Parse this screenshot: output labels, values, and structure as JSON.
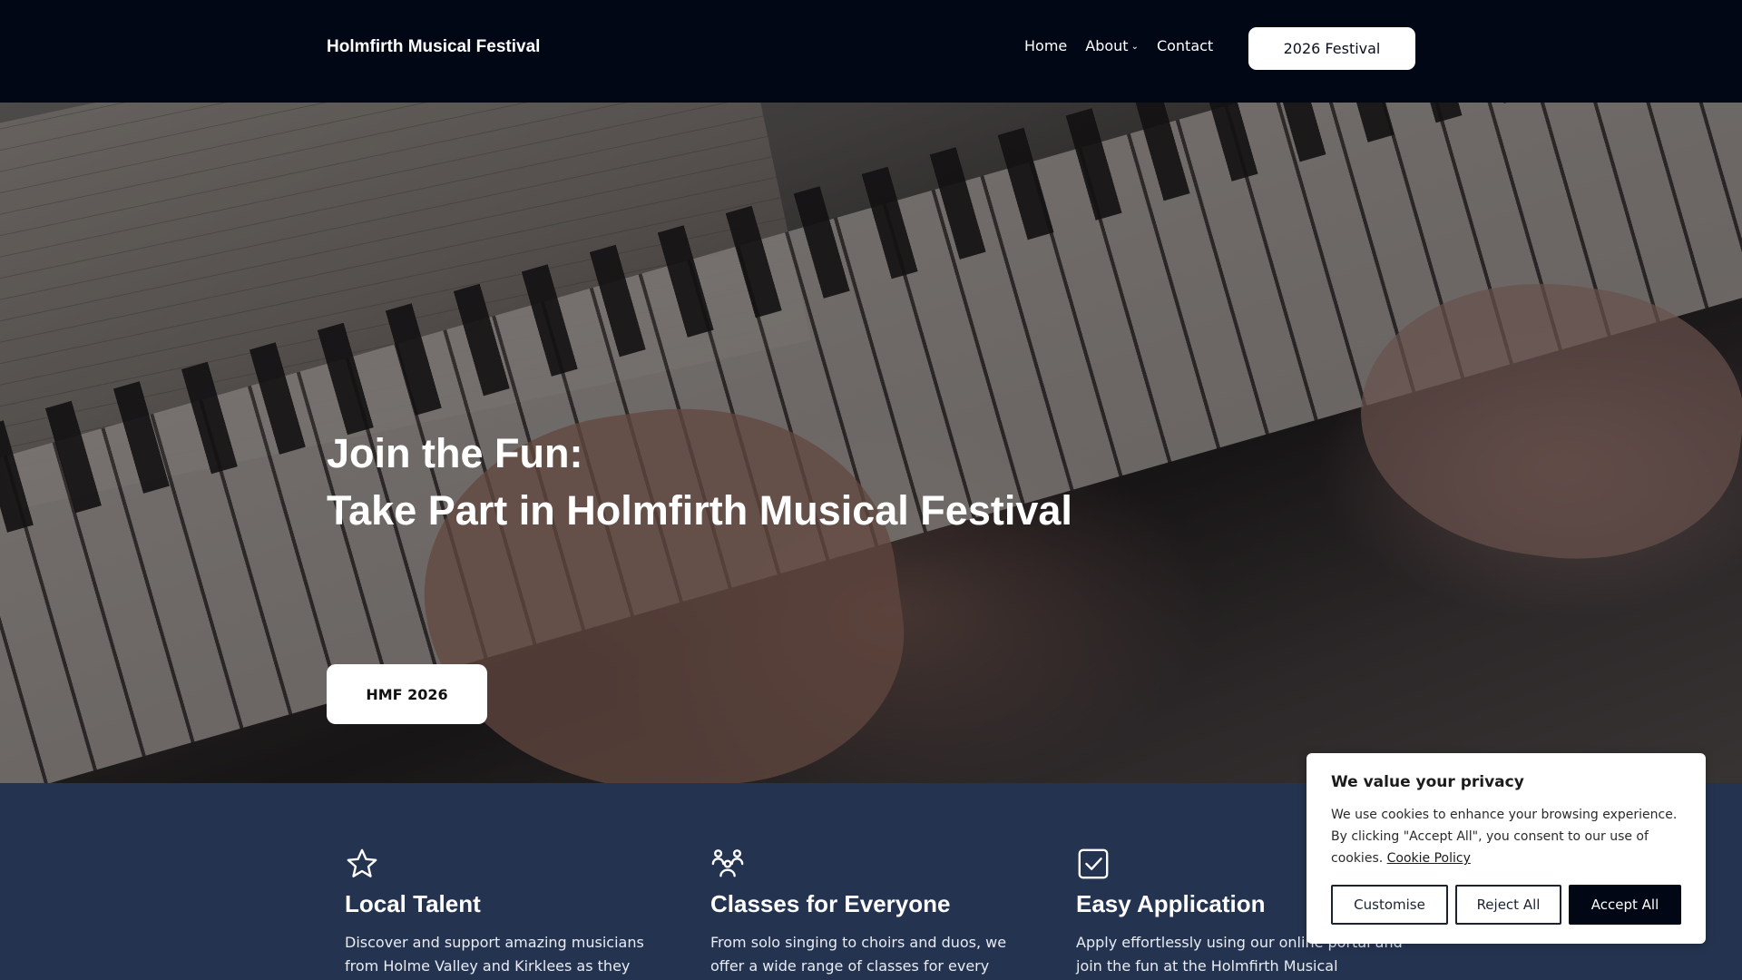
{
  "header": {
    "brand": "Holmfirth Musical Festival",
    "nav": [
      {
        "label": "Home"
      },
      {
        "label": "About",
        "has_dropdown": true
      },
      {
        "label": "Contact"
      }
    ],
    "cta_label": "2026 Festival"
  },
  "hero": {
    "title_line1": "Join the Fun:",
    "title_line2": "Take Part in Holmfirth Musical Festival",
    "button_label": "HMF 2026"
  },
  "features": [
    {
      "icon": "star-icon",
      "title": "Local Talent",
      "text": "Discover and support amazing musicians from Holme Valley and Kirklees as they"
    },
    {
      "icon": "group-icon",
      "title": "Classes for Everyone",
      "text": "From solo singing to choirs and duos, we offer a wide range of classes for every"
    },
    {
      "icon": "checkbox-icon",
      "title": "Easy Application",
      "text": "Apply effortlessly using our online portal and join the fun at the Holmfirth Musical"
    }
  ],
  "cookie_banner": {
    "title": "We value your privacy",
    "text": "We use cookies to enhance your browsing experience. By clicking \"Accept All\", you consent to our use of cookies.",
    "policy_link": "Cookie Policy",
    "buttons": {
      "customise": "Customise",
      "reject": "Reject All",
      "accept": "Accept All"
    }
  }
}
